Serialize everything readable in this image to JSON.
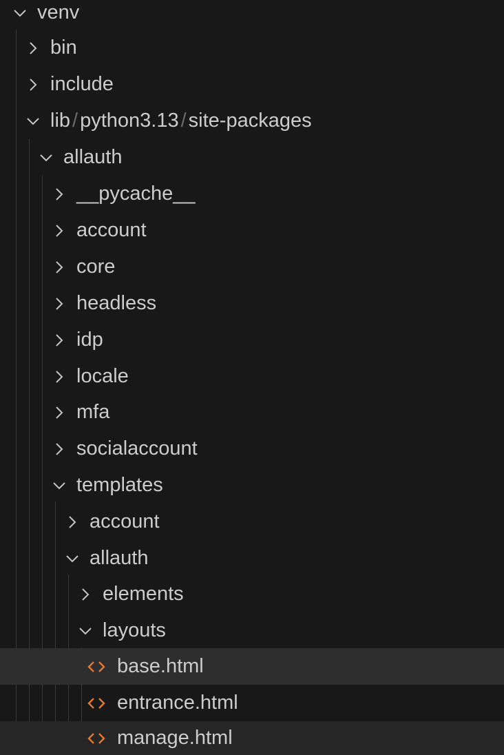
{
  "explorer": {
    "items": [
      {
        "name": "venv",
        "expanded": true,
        "kind": "folder"
      },
      {
        "name": "bin",
        "expanded": false,
        "kind": "folder"
      },
      {
        "name": "include",
        "expanded": false,
        "kind": "folder"
      },
      {
        "segments": [
          "lib",
          "python3.13",
          "site-packages"
        ],
        "separator": "/",
        "expanded": true,
        "kind": "folder"
      },
      {
        "name": "allauth",
        "expanded": true,
        "kind": "folder"
      },
      {
        "name": "__pycache__",
        "expanded": false,
        "kind": "folder"
      },
      {
        "name": "account",
        "expanded": false,
        "kind": "folder"
      },
      {
        "name": "core",
        "expanded": false,
        "kind": "folder"
      },
      {
        "name": "headless",
        "expanded": false,
        "kind": "folder"
      },
      {
        "name": "idp",
        "expanded": false,
        "kind": "folder"
      },
      {
        "name": "locale",
        "expanded": false,
        "kind": "folder"
      },
      {
        "name": "mfa",
        "expanded": false,
        "kind": "folder"
      },
      {
        "name": "socialaccount",
        "expanded": false,
        "kind": "folder"
      },
      {
        "name": "templates",
        "expanded": true,
        "kind": "folder"
      },
      {
        "name": "account",
        "expanded": false,
        "kind": "folder"
      },
      {
        "name": "allauth",
        "expanded": true,
        "kind": "folder"
      },
      {
        "name": "elements",
        "expanded": false,
        "kind": "folder"
      },
      {
        "name": "layouts",
        "expanded": true,
        "kind": "folder"
      },
      {
        "name": "base.html",
        "kind": "file",
        "icon": "html-file-icon",
        "selected": true
      },
      {
        "name": "entrance.html",
        "kind": "file",
        "icon": "html-file-icon"
      },
      {
        "name": "manage.html",
        "kind": "file",
        "icon": "html-file-icon",
        "hovered": true
      }
    ]
  },
  "colors": {
    "background": "#181818",
    "text": "#cccccc",
    "chevron": "#c5c5c5",
    "html_icon": "#e37933",
    "selected_row": "#2e2e2f",
    "hover_row": "#262627",
    "indent_guide": "#3a3a3a",
    "path_separator": "#6b6b6b"
  }
}
